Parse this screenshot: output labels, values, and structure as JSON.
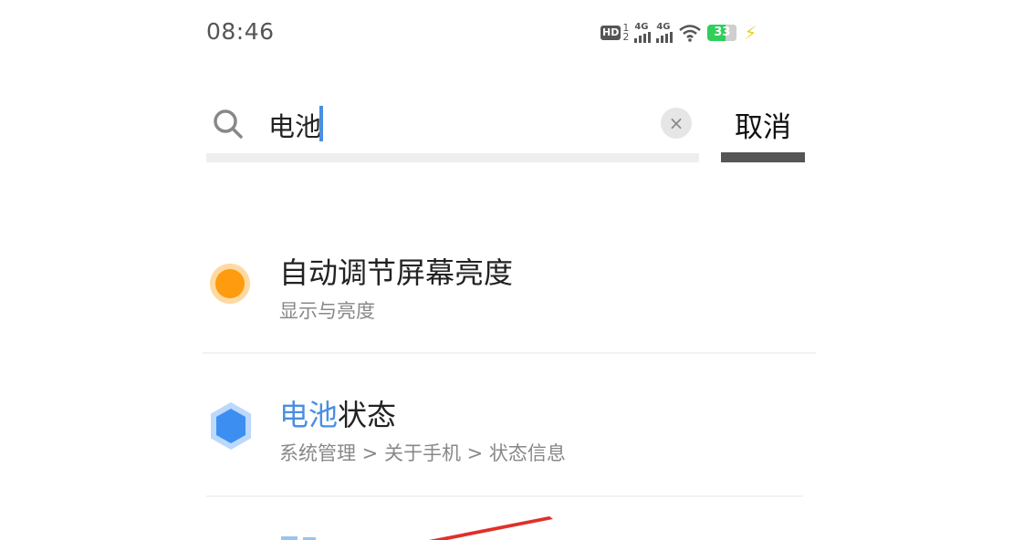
{
  "status_bar": {
    "time": "08:46",
    "hd_label": "HD",
    "hd_sub_top": "1",
    "hd_sub_bottom": "2",
    "sim1_label": "4G",
    "sim2_label": "4G",
    "battery_level": "33",
    "battery_color": "#2fcf5a",
    "icons": [
      "hd-voice-icon",
      "signal-icon",
      "signal-icon",
      "wifi-icon",
      "battery-icon",
      "charging-icon"
    ]
  },
  "search": {
    "query": "电池",
    "clear_icon": "×",
    "cancel_label": "取消"
  },
  "results": [
    {
      "title_prefix": "",
      "title_highlight": "",
      "title_rest": "自动调节屏幕亮度",
      "subtitle": "显示与亮度",
      "icon": "orange-dot-icon",
      "icon_color": "#ff9b0f"
    },
    {
      "title_prefix": "",
      "title_highlight": "电池",
      "title_rest": "状态",
      "subtitle": "系统管理 > 关于手机 > 状态信息",
      "icon": "blue-hexagon-icon",
      "icon_color": "#3c8ff0"
    }
  ],
  "colors": {
    "highlight": "#4a8fe0",
    "arrow": "#e0302a"
  }
}
